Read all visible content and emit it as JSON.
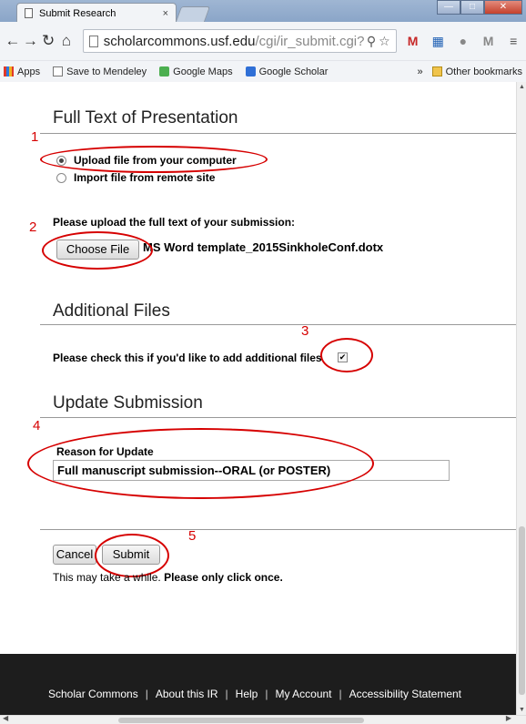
{
  "browser": {
    "tab_title": "Submit Research",
    "tab_close": "×",
    "url_host": "scholarcommons.usf.edu",
    "url_path": "/cgi/ir_submit.cgi?a",
    "bookmarks": [
      "Apps",
      "Save to Mendeley",
      "Google Maps",
      "Google Scholar"
    ],
    "bookmarks_overflow": "»",
    "other_bookmarks": "Other bookmarks"
  },
  "form": {
    "full_text_title": "Full Text of Presentation",
    "upload_option": "Upload file from your computer",
    "import_option": "Import file from remote site",
    "upload_prompt": "Please upload the full text of your submission:",
    "choose_file_label": "Choose File",
    "file_name": "MS Word template_2015SinkholeConf.dotx",
    "additional_files_title": "Additional Files",
    "additional_files_prompt": "Please check this if you'd like to add additional files",
    "update_title": "Update Submission",
    "reason_label": "Reason for Update",
    "reason_value": "Full manuscript submission--ORAL (or POSTER)",
    "cancel_label": "Cancel",
    "submit_label": "Submit",
    "note_prefix": "This may take a while.",
    "note_emphasis": "Please only click once."
  },
  "annotations": [
    "1",
    "2",
    "3",
    "4",
    "5"
  ],
  "footer": {
    "links": [
      "Scholar Commons",
      "About this IR",
      "Help",
      "My Account",
      "Accessibility Statement"
    ],
    "separator": "|"
  },
  "colors": {
    "annotation": "#d60000",
    "footer_bg": "#1d1d1d"
  }
}
